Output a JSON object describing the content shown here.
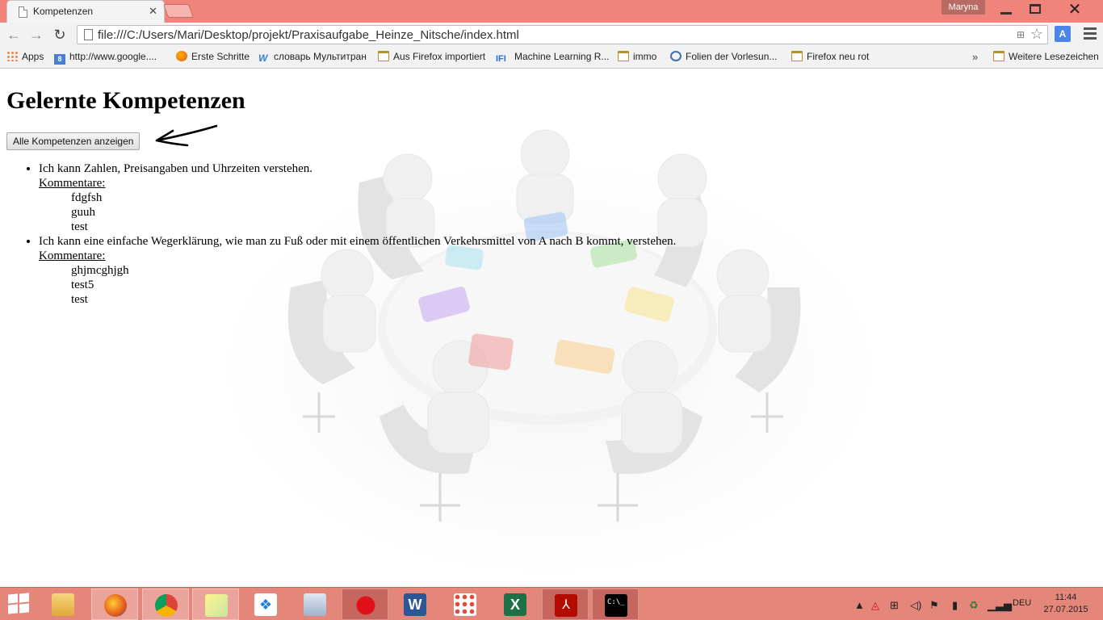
{
  "browser": {
    "tab_title": "Kompetenzen",
    "profile_name": "Maryna",
    "url": "file:///C:/Users/Mari/Desktop/projekt/Praxisaufgabe_Heinze_Nitsche/index.html"
  },
  "bookmarks": [
    {
      "label": "Apps",
      "icon": "apps-grid-icon"
    },
    {
      "label": "http://www.google....",
      "icon": "google-icon"
    },
    {
      "label": "Erste Schritte",
      "icon": "firefox-icon"
    },
    {
      "label": "словарь Мультитран",
      "icon": "multitran-icon"
    },
    {
      "label": "Aus Firefox importiert",
      "icon": "folder-icon"
    },
    {
      "label": "Machine Learning R...",
      "icon": "ifi-icon"
    },
    {
      "label": "immo",
      "icon": "folder-icon"
    },
    {
      "label": "Folien der Vorlesun...",
      "icon": "circle-icon"
    },
    {
      "label": "Firefox neu rot",
      "icon": "folder-icon"
    }
  ],
  "bookmarks_more": "»",
  "bookmarks_other": "Weitere Lesezeichen",
  "page": {
    "heading": "Gelernte Kompetenzen",
    "button_label": "Alle Kompetenzen anzeigen",
    "comments_label": "Kommentare:",
    "competences": [
      {
        "text": "Ich kann Zahlen, Preisangaben und Uhrzeiten verstehen.",
        "comments": [
          "fdgfsh",
          "guuh",
          "test"
        ]
      },
      {
        "text": "Ich kann eine einfache Wegerklärung, wie man zu Fuß oder mit einem öffentlichen Verkehrsmittel von A nach B kommt, verstehen.",
        "comments": [
          "ghjmcghjgh",
          "test5",
          "test"
        ]
      }
    ]
  },
  "taskbar": {
    "apps": [
      "file-explorer-icon",
      "firefox-icon",
      "chrome-icon",
      "sticky-notes-icon",
      "dropbox-icon",
      "calculator-icon",
      "paint-splash-icon",
      "word-icon",
      "apps-grid-icon",
      "excel-icon",
      "acrobat-icon",
      "cmd-icon"
    ],
    "language": "DEU",
    "time": "11:44",
    "date": "27.07.2015"
  },
  "colors": {
    "titlebar": "#f0847a",
    "taskbar": "#e5867b",
    "toolbar": "#f2f2f2"
  }
}
